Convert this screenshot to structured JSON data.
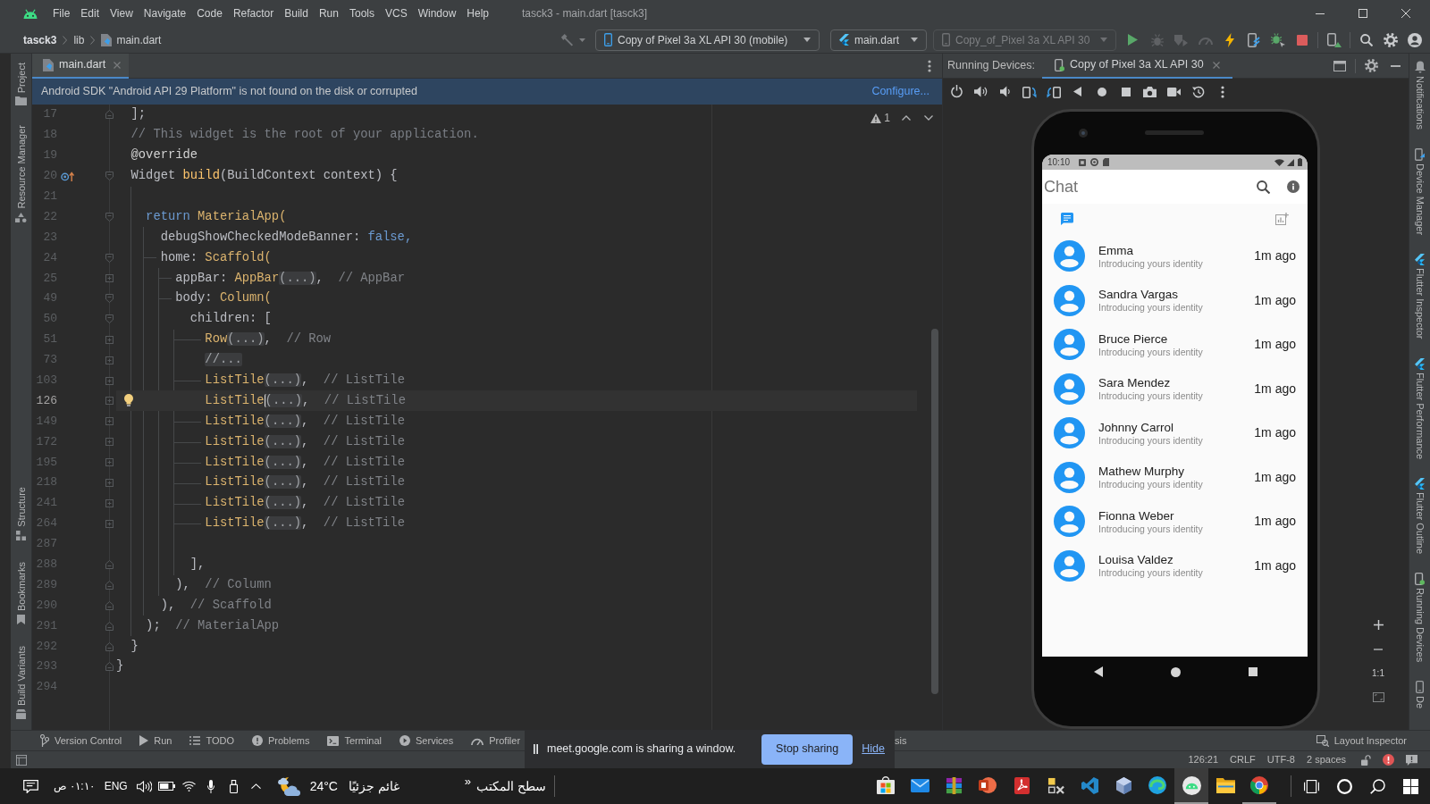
{
  "title_bar": {
    "menu": [
      "File",
      "Edit",
      "View",
      "Navigate",
      "Code",
      "Refactor",
      "Build",
      "Run",
      "Tools",
      "VCS",
      "Window",
      "Help"
    ],
    "title": "tasck3 - main.dart [tasck3]"
  },
  "navigation_bar": {
    "breadcrumbs": [
      "tasck3",
      "lib",
      "main.dart"
    ],
    "device_selector": "Copy of Pixel 3a XL API 30 (mobile)",
    "run_configuration": "main.dart",
    "emulator_selector": {
      "label": "Copy_of_Pixel 3a XL API 30",
      "disabled": true
    },
    "actions": [
      {
        "kind": "run",
        "disabled": false
      },
      {
        "kind": "debug",
        "disabled": true
      },
      {
        "kind": "coverage",
        "disabled": true
      },
      {
        "kind": "profile",
        "disabled": true
      },
      {
        "kind": "hot_reload",
        "disabled": false
      },
      {
        "kind": "device_reload",
        "disabled": false
      },
      {
        "kind": "attach_debugger",
        "disabled": false
      },
      {
        "kind": "stop",
        "disabled": false
      },
      {
        "kind": "device_manager",
        "disabled": false
      },
      {
        "kind": "search",
        "disabled": false
      },
      {
        "kind": "settings",
        "disabled": false
      },
      {
        "kind": "account",
        "disabled": false
      }
    ]
  },
  "left_stripe": {
    "top": [
      "Project",
      "Resource Manager"
    ],
    "bottom": [
      "Structure",
      "Bookmarks",
      "Build Variants"
    ]
  },
  "editor": {
    "tabs": [
      {
        "label": "main.dart",
        "selected": true
      }
    ],
    "banner": {
      "message": "Android SDK \"Android API 29 Platform\" is not found on the disk or corrupted",
      "action": "Configure..."
    },
    "warnings": "1",
    "lines": [
      {
        "number": "17",
        "fold_end": true,
        "current": false,
        "tokens": [
          {
            "text": "  ];",
            "kind": "plain"
          }
        ]
      },
      {
        "number": "18",
        "current": false,
        "tokens": [
          {
            "text": "  // This widget is the root of your application.",
            "kind": "comment"
          }
        ]
      },
      {
        "number": "19",
        "current": false,
        "tokens": [
          {
            "text": "  @override",
            "kind": "annotation"
          }
        ]
      },
      {
        "number": "20",
        "expanded": true,
        "override": true,
        "current": false,
        "tokens": [
          {
            "text": "  Widget ",
            "kind": "plain"
          },
          {
            "text": "build",
            "kind": "function"
          },
          {
            "text": "(BuildContext context) {",
            "kind": "plain"
          }
        ]
      },
      {
        "number": "21",
        "current": false
      },
      {
        "number": "22",
        "expanded": true,
        "current": false,
        "tokens": [
          {
            "text": "    return",
            "kind": "keyword"
          },
          {
            "text": " MaterialApp(",
            "kind": "class"
          }
        ]
      },
      {
        "number": "23",
        "current": false,
        "tokens": [
          {
            "text": "      debugShowCheckedModeBanner: ",
            "kind": "plain"
          },
          {
            "text": "false,",
            "kind": "keyword"
          }
        ]
      },
      {
        "number": "24",
        "expanded": true,
        "current": false,
        "tokens": [
          {
            "text": "      home: ",
            "kind": "plain"
          },
          {
            "text": "Scaffold(",
            "kind": "class"
          }
        ]
      },
      {
        "number": "25",
        "expanded": false,
        "current": false,
        "tokens": [
          {
            "text": "        appBar: ",
            "kind": "plain"
          },
          {
            "text": "AppBar",
            "kind": "class"
          },
          {
            "text": "(...)",
            "kind": "folded"
          },
          {
            "text": ",  ",
            "kind": "plain"
          },
          {
            "text": "// AppBar",
            "kind": "hint"
          }
        ]
      },
      {
        "number": "49",
        "expanded": true,
        "current": false,
        "tokens": [
          {
            "text": "        body: ",
            "kind": "plain"
          },
          {
            "text": "Column(",
            "kind": "class"
          }
        ]
      },
      {
        "number": "50",
        "expanded": true,
        "current": false,
        "tokens": [
          {
            "text": "          children: [",
            "kind": "plain"
          }
        ]
      },
      {
        "number": "51",
        "expanded": false,
        "current": false,
        "tokens": [
          {
            "text": "            Row",
            "kind": "class"
          },
          {
            "text": "(...)",
            "kind": "folded"
          },
          {
            "text": ",  ",
            "kind": "plain"
          },
          {
            "text": "// Row",
            "kind": "hint"
          }
        ]
      },
      {
        "number": "73",
        "expanded": false,
        "current": false,
        "tokens": [
          {
            "text": "            //...",
            "kind": "folded"
          }
        ]
      },
      {
        "number": "103",
        "expanded": false,
        "current": false,
        "tokens": [
          {
            "text": "            ListTile",
            "kind": "class"
          },
          {
            "text": "(...)",
            "kind": "folded"
          },
          {
            "text": ",  ",
            "kind": "plain"
          },
          {
            "text": "// ListTile",
            "kind": "hint"
          }
        ]
      },
      {
        "number": "126",
        "expanded": false,
        "intention_available": true,
        "current": true,
        "tokens": [
          {
            "text": "            ListTile",
            "kind": "class"
          },
          {
            "kind": "caret"
          },
          {
            "text": "(...)",
            "kind": "folded"
          },
          {
            "text": ",  ",
            "kind": "plain"
          },
          {
            "text": "// ListTile",
            "kind": "hint"
          }
        ]
      },
      {
        "number": "149",
        "expanded": false,
        "current": false,
        "tokens": [
          {
            "text": "            ListTile",
            "kind": "class"
          },
          {
            "text": "(...)",
            "kind": "folded"
          },
          {
            "text": ",  ",
            "kind": "plain"
          },
          {
            "text": "// ListTile",
            "kind": "hint"
          }
        ]
      },
      {
        "number": "172",
        "expanded": false,
        "current": false,
        "tokens": [
          {
            "text": "            ListTile",
            "kind": "class"
          },
          {
            "text": "(...)",
            "kind": "folded"
          },
          {
            "text": ",  ",
            "kind": "plain"
          },
          {
            "text": "// ListTile",
            "kind": "hint"
          }
        ]
      },
      {
        "number": "195",
        "expanded": false,
        "current": false,
        "tokens": [
          {
            "text": "            ListTile",
            "kind": "class"
          },
          {
            "text": "(...)",
            "kind": "folded"
          },
          {
            "text": ",  ",
            "kind": "plain"
          },
          {
            "text": "// ListTile",
            "kind": "hint"
          }
        ]
      },
      {
        "number": "218",
        "expanded": false,
        "current": false,
        "tokens": [
          {
            "text": "            ListTile",
            "kind": "class"
          },
          {
            "text": "(...)",
            "kind": "folded"
          },
          {
            "text": ",  ",
            "kind": "plain"
          },
          {
            "text": "// ListTile",
            "kind": "hint"
          }
        ]
      },
      {
        "number": "241",
        "expanded": false,
        "current": false,
        "tokens": [
          {
            "text": "            ListTile",
            "kind": "class"
          },
          {
            "text": "(...)",
            "kind": "folded"
          },
          {
            "text": ",  ",
            "kind": "plain"
          },
          {
            "text": "// ListTile",
            "kind": "hint"
          }
        ]
      },
      {
        "number": "264",
        "expanded": false,
        "current": false,
        "tokens": [
          {
            "text": "            ListTile",
            "kind": "class"
          },
          {
            "text": "(...)",
            "kind": "folded"
          },
          {
            "text": ",  ",
            "kind": "plain"
          },
          {
            "text": "// ListTile",
            "kind": "hint"
          }
        ]
      },
      {
        "number": "287",
        "current": false
      },
      {
        "number": "288",
        "fold_end": true,
        "current": false,
        "tokens": [
          {
            "text": "          ],",
            "kind": "plain"
          }
        ]
      },
      {
        "number": "289",
        "fold_end": true,
        "current": false,
        "tokens": [
          {
            "text": "        ),  ",
            "kind": "plain"
          },
          {
            "text": "// Column",
            "kind": "hint"
          }
        ]
      },
      {
        "number": "290",
        "fold_end": true,
        "current": false,
        "tokens": [
          {
            "text": "      ),  ",
            "kind": "plain"
          },
          {
            "text": "// Scaffold",
            "kind": "hint"
          }
        ]
      },
      {
        "number": "291",
        "fold_end": true,
        "current": false,
        "tokens": [
          {
            "text": "    );  ",
            "kind": "plain"
          },
          {
            "text": "// MaterialApp",
            "kind": "hint"
          }
        ]
      },
      {
        "number": "292",
        "fold_end": true,
        "current": false,
        "tokens": [
          {
            "text": "  }",
            "kind": "plain"
          }
        ]
      },
      {
        "number": "293",
        "fold_end": true,
        "current": false,
        "tokens": [
          {
            "text": "}",
            "kind": "plain"
          }
        ]
      },
      {
        "number": "294",
        "current": false
      }
    ]
  },
  "running_devices": {
    "title": "Running Devices:",
    "tabs": [
      {
        "label": "Copy of Pixel 3a XL API 30",
        "selected": true
      }
    ],
    "zoom_label": "1:1",
    "device": {
      "status_time": "10:10",
      "app_title": "Chat",
      "tabs": [
        {
          "selected": true
        },
        {
          "selected": false
        }
      ],
      "chats": [
        {
          "name": "Emma",
          "message": "Introducing yours identity",
          "time": "1m ago"
        },
        {
          "name": "Sandra Vargas",
          "message": "Introducing yours identity",
          "time": "1m ago"
        },
        {
          "name": "Bruce Pierce",
          "message": "Introducing yours identity",
          "time": "1m ago"
        },
        {
          "name": "Sara Mendez",
          "message": "Introducing yours identity",
          "time": "1m ago"
        },
        {
          "name": "Johnny Carrol",
          "message": "Introducing yours identity",
          "time": "1m ago"
        },
        {
          "name": "Mathew Murphy",
          "message": "Introducing yours identity",
          "time": "1m ago"
        },
        {
          "name": "Fionna Weber",
          "message": "Introducing yours identity",
          "time": "1m ago"
        },
        {
          "name": "Louisa Valdez",
          "message": "Introducing yours identity",
          "time": "1m ago"
        }
      ]
    }
  },
  "right_stripe": [
    "Notifications",
    "Device Manager",
    "Flutter Inspector",
    "Flutter Performance",
    "Flutter Outline",
    "Running Devices",
    "De"
  ],
  "bottom_bar": {
    "tools": [
      "Version Control",
      "Run",
      "TODO",
      "Problems",
      "Terminal",
      "Services",
      "Profiler"
    ],
    "partly_covered_tool": "sis",
    "layout_inspector": "Layout Inspector"
  },
  "status_bar": {
    "position": "126:21",
    "line_separator": "CRLF",
    "encoding": "UTF-8",
    "indent": "2 spaces"
  },
  "sharing_bar": {
    "message": "meet.google.com is sharing a window.",
    "stop_button": "Stop sharing",
    "hide_link": "Hide"
  },
  "taskbar": {
    "clock": "٠١:١٠ ص",
    "language": "ENG",
    "weather": {
      "temperature": "24°C",
      "condition": "غائم جزئيًا"
    },
    "desktop_toolbar": {
      "chevron": "»",
      "label": "سطح المكتب"
    },
    "apps": [
      {
        "selected": false,
        "running": false
      },
      {
        "selected": false,
        "running": false
      },
      {
        "selected": false,
        "running": false
      },
      {
        "selected": false,
        "running": false
      },
      {
        "selected": false,
        "running": false
      },
      {
        "selected": false,
        "running": false
      },
      {
        "selected": false,
        "running": false
      },
      {
        "selected": false,
        "running": false
      },
      {
        "selected": false,
        "running": false
      },
      {
        "selected": true,
        "running": true
      },
      {
        "selected": false,
        "running": false
      },
      {
        "selected": false,
        "running": true
      }
    ]
  }
}
